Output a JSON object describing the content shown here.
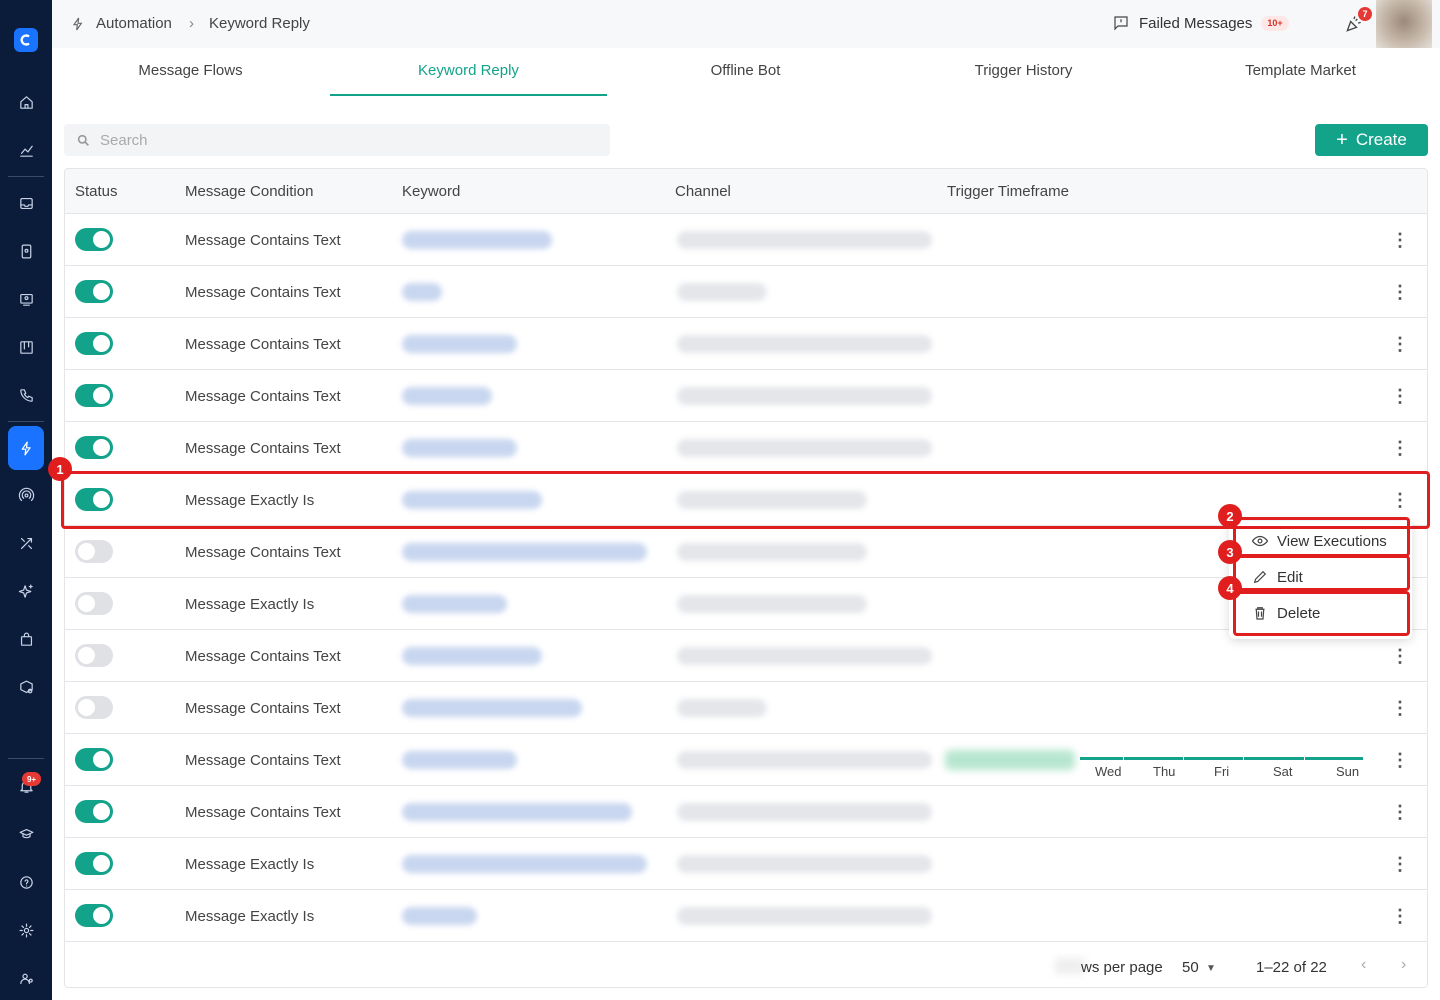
{
  "sidebar": {
    "notification_badge": "9+",
    "icons": [
      "home-icon",
      "analytics-icon",
      "inbox-icon",
      "contacts-icon",
      "tickets-icon",
      "board-icon",
      "phone-icon",
      "automation-icon",
      "broadcast-icon",
      "tools-icon",
      "ai-sparkle-icon",
      "commerce-icon",
      "integrations-icon",
      "notifications-icon",
      "academy-icon",
      "help-icon",
      "settings-icon",
      "team-icon"
    ]
  },
  "header": {
    "breadcrumb": [
      "Automation",
      "Keyword Reply"
    ],
    "failed_messages_label": "Failed Messages",
    "failed_messages_count": "10+",
    "announcements_count": "7"
  },
  "tabs": [
    "Message Flows",
    "Keyword Reply",
    "Offline Bot",
    "Trigger History",
    "Template Market"
  ],
  "active_tab": "Keyword Reply",
  "search": {
    "placeholder": "Search",
    "value": ""
  },
  "create_label": "Create",
  "table": {
    "columns": [
      "Status",
      "Message Condition",
      "Keyword",
      "Channel",
      "Trigger Timeframe"
    ],
    "rows": [
      {
        "enabled": true,
        "condition": "Message Contains Text"
      },
      {
        "enabled": true,
        "condition": "Message Contains Text"
      },
      {
        "enabled": true,
        "condition": "Message Contains Text"
      },
      {
        "enabled": true,
        "condition": "Message Contains Text"
      },
      {
        "enabled": true,
        "condition": "Message Contains Text"
      },
      {
        "enabled": true,
        "condition": "Message Exactly Is"
      },
      {
        "enabled": false,
        "condition": "Message Contains Text"
      },
      {
        "enabled": false,
        "condition": "Message Exactly Is"
      },
      {
        "enabled": false,
        "condition": "Message Contains Text"
      },
      {
        "enabled": false,
        "condition": "Message Contains Text"
      },
      {
        "enabled": true,
        "condition": "Message Contains Text"
      },
      {
        "enabled": true,
        "condition": "Message Contains Text"
      },
      {
        "enabled": true,
        "condition": "Message Exactly Is"
      },
      {
        "enabled": true,
        "condition": "Message Exactly Is"
      }
    ],
    "timeframe_days": [
      "Wed",
      "Thu",
      "Fri",
      "Sat",
      "Sun"
    ]
  },
  "pagination": {
    "rows_per_page_label": "ws per page",
    "rows_per_page": "50",
    "range": "1–22 of 22"
  },
  "context_menu": {
    "items": [
      "View Executions",
      "Edit",
      "Delete"
    ]
  },
  "annotations": [
    "1",
    "2",
    "3",
    "4"
  ],
  "colors": {
    "accent": "#12a38a",
    "sidebar": "#0b1b3a",
    "active_nav": "#1a73ff",
    "highlight": "#e01e1e"
  }
}
